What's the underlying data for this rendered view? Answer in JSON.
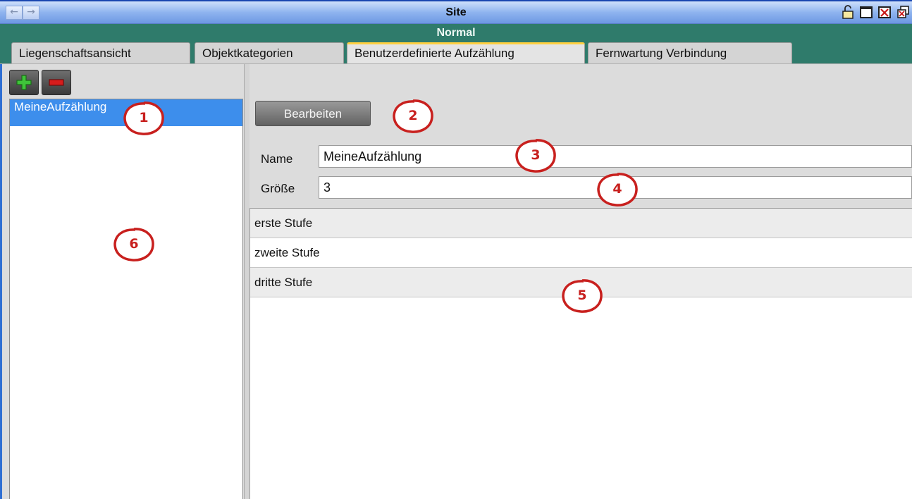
{
  "window": {
    "title": "Site",
    "nav_back_glyph": "←",
    "nav_forward_glyph": "→",
    "controls": [
      "lock-icon",
      "maximize-icon",
      "close-icon",
      "restore-icon"
    ]
  },
  "mode": {
    "label": "Normal"
  },
  "tabs": [
    {
      "label": "Liegenschaftsansicht"
    },
    {
      "label": "Objektkategorien"
    },
    {
      "label": "Benutzerdefinierte Aufzählung",
      "active": true
    },
    {
      "label": "Fernwartung Verbindung"
    }
  ],
  "left_panel": {
    "add_icon": "plus-icon",
    "remove_icon": "minus-icon",
    "items": [
      {
        "label": "MeineAufzählung",
        "selected": true
      }
    ]
  },
  "right_panel": {
    "edit_button_label": "Bearbeiten",
    "name_label": "Name",
    "name_value": "MeineAufzählung",
    "size_label": "Größe",
    "size_value": "3",
    "values": [
      "erste Stufe",
      "zweite Stufe",
      "dritte Stufe"
    ]
  },
  "annotations": [
    "1",
    "2",
    "3",
    "4",
    "5",
    "6"
  ],
  "colors": {
    "titlebar": "#8fb4ef",
    "modebar": "#2f7b6b",
    "selection": "#3d8eec",
    "marker": "#c8201e",
    "active_tab_accent": "#ffd040"
  }
}
